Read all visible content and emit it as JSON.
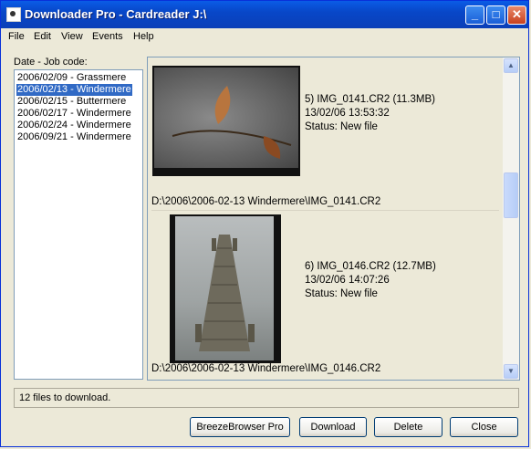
{
  "window": {
    "title": "Downloader Pro - Cardreader J:\\"
  },
  "menu": [
    "File",
    "Edit",
    "View",
    "Events",
    "Help"
  ],
  "jobs": {
    "label": "Date - Job code:",
    "items": [
      "2006/02/09 - Grassmere",
      "2006/02/13 - Windermere",
      "2006/02/15 - Buttermere",
      "2006/02/17 - Windermere",
      "2006/02/24 - Windermere",
      "2006/09/21 - Windermere"
    ],
    "selected_index": 1
  },
  "files": [
    {
      "line1": "5) IMG_0141.CR2 (11.3MB)",
      "line2": "13/02/06 13:53:32",
      "line3": "Status: New file",
      "path": "D:\\2006\\2006-02-13 Windermere\\IMG_0141.CR2"
    },
    {
      "line1": "6) IMG_0146.CR2 (12.7MB)",
      "line2": "13/02/06 14:07:26",
      "line3": "Status: New file",
      "path": "D:\\2006\\2006-02-13 Windermere\\IMG_0146.CR2"
    }
  ],
  "status_text": "12 files to download.",
  "buttons": {
    "breeze": "BreezeBrowser Pro",
    "download": "Download",
    "delete": "Delete",
    "close": "Close"
  }
}
